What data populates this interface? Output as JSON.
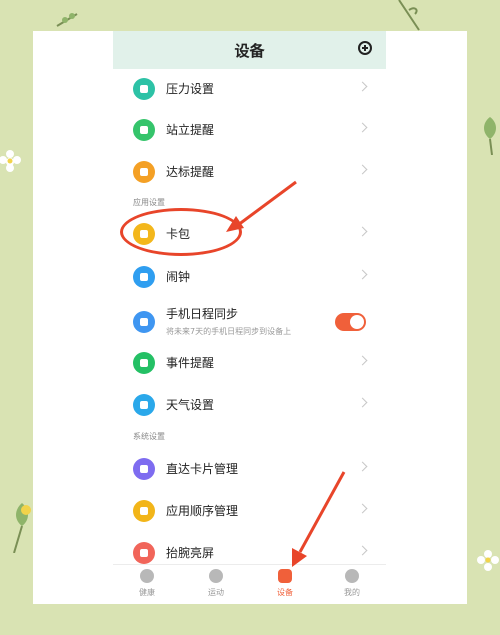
{
  "header": {
    "title": "设备"
  },
  "rows": {
    "pressure": {
      "label": "压力设置",
      "color": "#2dc2a6"
    },
    "stand": {
      "label": "站立提醒",
      "color": "#35c46b"
    },
    "goal": {
      "label": "达标提醒",
      "color": "#f4a025"
    },
    "wallet": {
      "label": "卡包",
      "color": "#f3b71c"
    },
    "alarm": {
      "label": "闹钟",
      "color": "#2f9ef0"
    },
    "calendar": {
      "label": "手机日程同步",
      "sub": "将未来7天的手机日程同步到设备上",
      "color": "#3f96f1",
      "toggle_on": true
    },
    "event": {
      "label": "事件提醒",
      "color": "#24c065"
    },
    "weather": {
      "label": "天气设置",
      "color": "#2aa8ea"
    },
    "cards": {
      "label": "直达卡片管理",
      "color": "#7e6cf0"
    },
    "apporder": {
      "label": "应用顺序管理",
      "color": "#f2b519"
    },
    "wrist": {
      "label": "抬腕亮屏",
      "color": "#f1655a"
    }
  },
  "sections": {
    "app_settings": "应用设置",
    "system_settings": "系统设置"
  },
  "tabs": [
    {
      "label": "健康",
      "icon": "ring-icon"
    },
    {
      "label": "运动",
      "icon": "shoe-icon"
    },
    {
      "label": "设备",
      "icon": "watch-icon"
    },
    {
      "label": "我的",
      "icon": "person-icon"
    }
  ],
  "colors": {
    "accent": "#f0603a",
    "annotation": "#e8452a",
    "background": "#d9e3b3"
  }
}
